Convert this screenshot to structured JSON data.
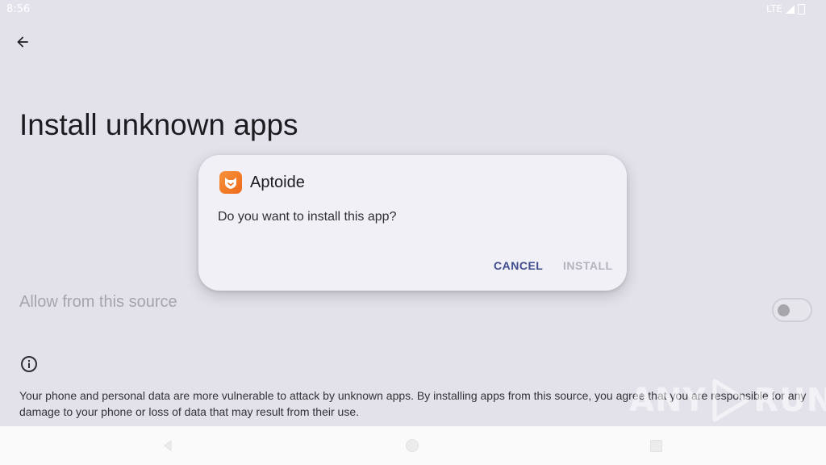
{
  "status_bar": {
    "time": "8:56",
    "network": "LTE",
    "signal_icon": "signal-icon",
    "battery_icon": "battery-icon"
  },
  "header": {
    "back_icon": "arrow-left-icon",
    "title": "Install unknown apps"
  },
  "settings": {
    "allow_label": "Allow from this source",
    "allow_enabled": false,
    "info_icon": "info-icon",
    "warning_text": "Your phone and personal data are more vulnerable to attack by unknown apps. By installing apps from this source, you agree that you are responsible for any damage to your phone or loss of data that may result from their use."
  },
  "dialog": {
    "app_name": "Aptoide",
    "app_icon": "aptoide-app-icon",
    "message": "Do you want to install this app?",
    "cancel_label": "CANCEL",
    "install_label": "INSTALL",
    "install_enabled": false
  },
  "nav_bar": {
    "back_icon": "nav-back-icon",
    "home_icon": "nav-home-icon",
    "recents_icon": "nav-recents-icon"
  },
  "watermark": {
    "text_left": "ANY",
    "text_right": "RUN"
  },
  "colors": {
    "background_dimmed": "#e3e2ea",
    "dialog_surface": "#f1f0f7",
    "accent": "#404c8c",
    "disabled_text": "#b4b3bb",
    "app_icon_orange": "#f0761f"
  }
}
